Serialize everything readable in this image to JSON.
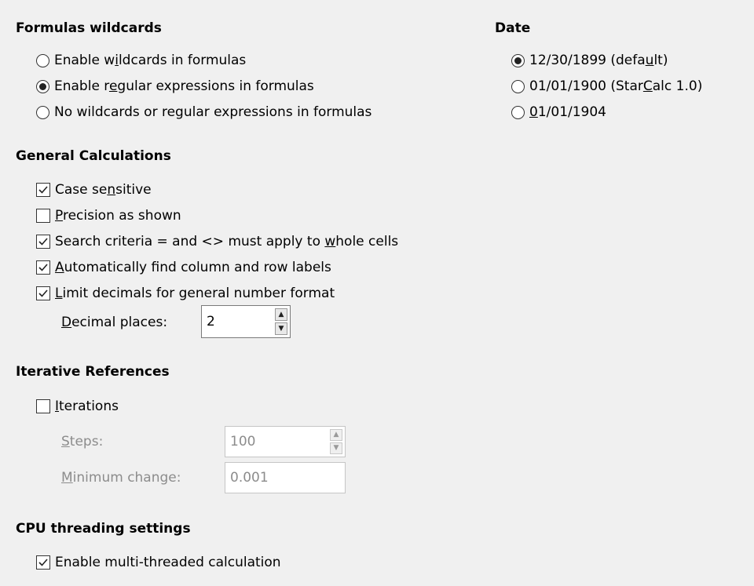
{
  "formulas_wildcards": {
    "title": "Formulas wildcards",
    "options": [
      {
        "label_pre": "Enable w",
        "label_u": "i",
        "label_post": "ldcards in formulas",
        "selected": false
      },
      {
        "label_pre": "Enable r",
        "label_u": "e",
        "label_post": "gular expressions in formulas",
        "selected": true
      },
      {
        "label_pre": "No wildcards or regular expressions in formulas",
        "label_u": "",
        "label_post": "",
        "selected": false
      }
    ]
  },
  "date": {
    "title": "Date",
    "options": [
      {
        "label_pre": "12/30/1899 (defa",
        "label_u": "u",
        "label_post": "lt)",
        "selected": true
      },
      {
        "label_pre": "01/01/1900 (Star",
        "label_u": "C",
        "label_post": "alc 1.0)",
        "selected": false
      },
      {
        "label_pre": "",
        "label_u": "0",
        "label_post": "1/01/1904",
        "selected": false
      }
    ]
  },
  "general": {
    "title": "General Calculations",
    "options": [
      {
        "label_pre": "Case se",
        "label_u": "n",
        "label_post": "sitive",
        "checked": true
      },
      {
        "label_pre": "",
        "label_u": "P",
        "label_post": "recision as shown",
        "checked": false
      },
      {
        "label_pre": "Search criteria = and <> must apply to ",
        "label_u": "w",
        "label_post": "hole cells",
        "checked": true
      },
      {
        "label_pre": "",
        "label_u": "A",
        "label_post": "utomatically find column and row labels",
        "checked": true
      },
      {
        "label_pre": "",
        "label_u": "L",
        "label_post": "imit decimals for general number format",
        "checked": true
      }
    ],
    "decimal_label_u": "D",
    "decimal_label_post": "ecimal places:",
    "decimal_value": "2"
  },
  "iterative": {
    "title": "Iterative References",
    "iterations_u": "I",
    "iterations_post": "terations",
    "iterations_checked": false,
    "steps_u": "S",
    "steps_post": "teps:",
    "steps_value": "100",
    "minchange_u": "M",
    "minchange_post": "inimum change:",
    "minchange_value": "0.001"
  },
  "cpu": {
    "title": "CPU threading settings",
    "label": "Enable multi-threaded calculation",
    "checked": true
  }
}
